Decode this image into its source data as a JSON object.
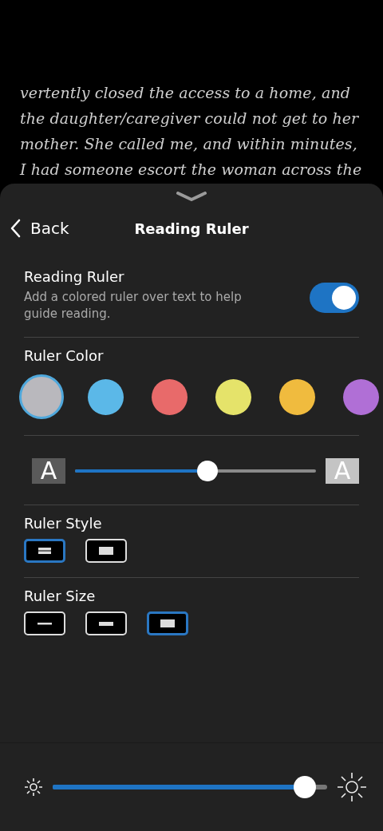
{
  "book_text": [
    "vertently closed the access to a home, and",
    "the daughter/caregiver could not get to her",
    "mother. She called me, and within minutes,",
    "I had someone escort the woman across the"
  ],
  "header": {
    "back": "Back",
    "title": "Reading Ruler"
  },
  "ruler_toggle": {
    "title": "Reading Ruler",
    "description": "Add a colored ruler over text to help guide reading.",
    "on": true
  },
  "ruler_color": {
    "title": "Ruler Color",
    "swatches": [
      {
        "color": "#b9b8bd",
        "selected": true
      },
      {
        "color": "#5bb8e8",
        "selected": false
      },
      {
        "color": "#e86a6a",
        "selected": false
      },
      {
        "color": "#e5e36a",
        "selected": false
      },
      {
        "color": "#f0bb3e",
        "selected": false
      },
      {
        "color": "#b06fd6",
        "selected": false
      }
    ]
  },
  "opacity_slider": {
    "min_label": "A",
    "max_label": "A",
    "level": 0.55
  },
  "ruler_style": {
    "title": "Ruler Style",
    "options": [
      {
        "kind": "lines",
        "selected": true
      },
      {
        "kind": "block",
        "selected": false
      }
    ]
  },
  "ruler_size": {
    "title": "Ruler Size",
    "options": [
      {
        "kind": "thin",
        "selected": false
      },
      {
        "kind": "medium",
        "selected": false
      },
      {
        "kind": "thick",
        "selected": true
      }
    ]
  },
  "brightness": {
    "level": 0.92
  }
}
